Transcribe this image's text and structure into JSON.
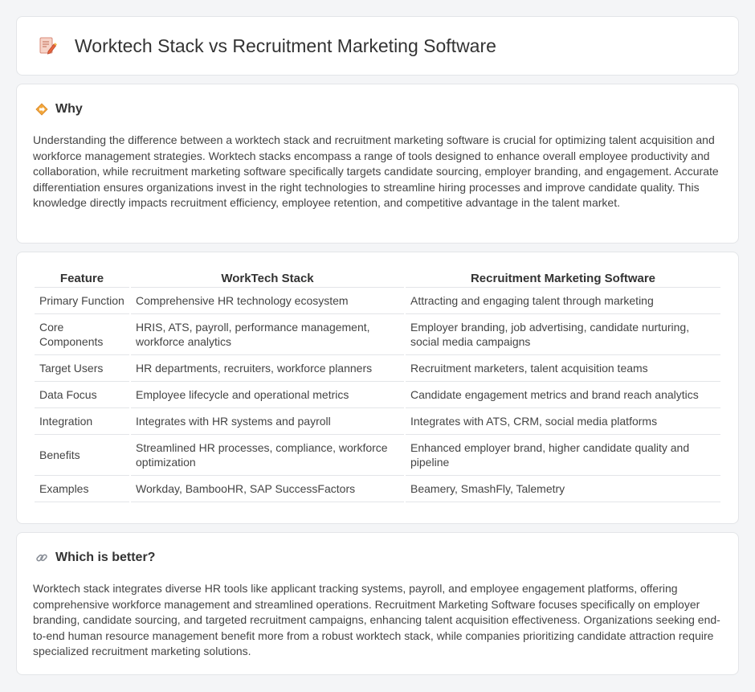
{
  "header": {
    "title": "Worktech Stack vs Recruitment Marketing Software"
  },
  "why": {
    "title": "Why",
    "body": "Understanding the difference between a worktech stack and recruitment marketing software is crucial for optimizing talent acquisition and workforce management strategies. Worktech stacks encompass a range of tools designed to enhance overall employee productivity and collaboration, while recruitment marketing software specifically targets candidate sourcing, employer branding, and engagement. Accurate differentiation ensures organizations invest in the right technologies to streamline hiring processes and improve candidate quality. This knowledge directly impacts recruitment efficiency, employee retention, and competitive advantage in the talent market."
  },
  "table": {
    "headers": [
      "Feature",
      "WorkTech Stack",
      "Recruitment Marketing Software"
    ],
    "rows": [
      [
        "Primary Function",
        "Comprehensive HR technology ecosystem",
        "Attracting and engaging talent through marketing"
      ],
      [
        "Core Components",
        "HRIS, ATS, payroll, performance management, workforce analytics",
        "Employer branding, job advertising, candidate nurturing, social media campaigns"
      ],
      [
        "Target Users",
        "HR departments, recruiters, workforce planners",
        "Recruitment marketers, talent acquisition teams"
      ],
      [
        "Data Focus",
        "Employee lifecycle and operational metrics",
        "Candidate engagement metrics and brand reach analytics"
      ],
      [
        "Integration",
        "Integrates with HR systems and payroll",
        "Integrates with ATS, CRM, social media platforms"
      ],
      [
        "Benefits",
        "Streamlined HR processes, compliance, workforce optimization",
        "Enhanced employer brand, higher candidate quality and pipeline"
      ],
      [
        "Examples",
        "Workday, BambooHR, SAP SuccessFactors",
        "Beamery, SmashFly, Talemetry"
      ]
    ]
  },
  "better": {
    "title": "Which is better?",
    "body": "Worktech stack integrates diverse HR tools like applicant tracking systems, payroll, and employee engagement platforms, offering comprehensive workforce management and streamlined operations. Recruitment Marketing Software focuses specifically on employer branding, candidate sourcing, and targeted recruitment campaigns, enhancing talent acquisition effectiveness. Organizations seeking end-to-end human resource management benefit more from a robust worktech stack, while companies prioritizing candidate attraction require specialized recruitment marketing solutions."
  },
  "icons": {
    "header": "document-pencil-icon",
    "why": "diamond-warning-icon",
    "better": "link-icon"
  }
}
